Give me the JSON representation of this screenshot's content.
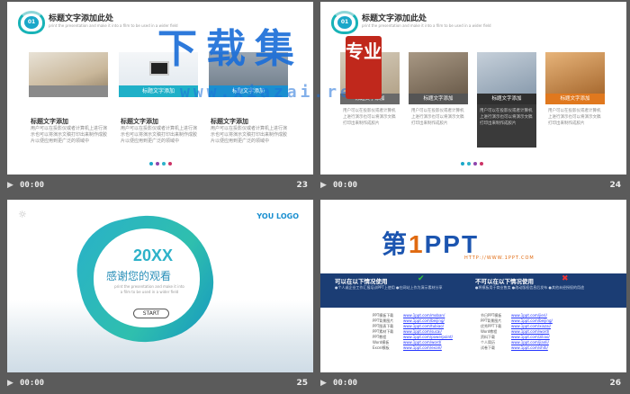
{
  "slides": [
    {
      "number": "23",
      "time": "00:00",
      "badge": "01",
      "title": "标题文字添加此处",
      "subtitle": "print the presentation and make it into a film to be used in a wider field",
      "photos": [
        {
          "caption": "",
          "color": "#c9b79a"
        },
        {
          "caption": "标题文字添加",
          "color": "#dfe7ee"
        },
        {
          "caption": "标题文字添加",
          "color": "#b8c2cc"
        }
      ],
      "photo_caption_colors": [
        "#8a8a8a",
        "#1fb0c8",
        "#1a8fd0"
      ],
      "columns": [
        {
          "title": "标题文字添加",
          "text": "用户可以在投影仪或者计算机上进行演示也可以将演示文稿打印出来制作成胶片以便应用到更广泛的领域中"
        },
        {
          "title": "标题文字添加",
          "text": "用户可以在投影仪或者计算机上进行演示也可以将演示文稿打印出来制作成胶片以便应用到更广泛的领域中"
        },
        {
          "title": "标题文字添加",
          "text": "用户可以在投影仪或者计算机上进行演示也可以将演示文稿打印出来制作成胶片以便应用到更广泛的领域中"
        }
      ],
      "dot_colors": [
        "#1aa7c9",
        "#8e44ad",
        "#2eb2c9",
        "#cc3366"
      ]
    },
    {
      "number": "24",
      "time": "00:00",
      "badge": "01",
      "title": "标题文字添加此处",
      "subtitle": "print the presentation and make it into a film to be used in a wider field",
      "cards": [
        {
          "caption": "标题文字添加",
          "text": "用户可以在投影仪或者计算机上进行演示也可以将演示文稿打印出来制作成胶片",
          "color": "#b4a48a",
          "cap_color": "#6a6a6a"
        },
        {
          "caption": "标题文字添加",
          "text": "用户可以在投影仪或者计算机上进行演示也可以将演示文稿打印出来制作成胶片",
          "color": "#8a7a66",
          "cap_color": "#555"
        },
        {
          "caption": "标题文字添加",
          "text": "用户可以在投影仪或者计算机上进行演示也可以将演示文稿打印出来制作成胶片",
          "color": "#9fb0c2",
          "cap_color": "#2f2f2f"
        },
        {
          "caption": "标题文字添加",
          "text": "用户可以在投影仪或者计算机上进行演示也可以将演示文稿打印出来制作成胶片",
          "color": "#c98a4a",
          "cap_color": "#e0781e"
        }
      ],
      "dot_colors": [
        "#1aa7c9",
        "#2eb2c9",
        "#8e44ad",
        "#cc3366"
      ]
    },
    {
      "number": "25",
      "time": "00:00",
      "logo": "YOU LOGO",
      "year": "20XX",
      "thanks": "感谢您的观看",
      "sub": "print the presentation and make it into a film to be used in a wider field",
      "start": "START"
    },
    {
      "number": "26",
      "time": "00:00",
      "logo_a": "第",
      "logo_one": "1",
      "logo_b": "PPT",
      "url": "HTTP://WWW.1PPT.COM",
      "allowed_title": "可以在以下情况使用",
      "allowed_text": "●个人或企业工作汇报培训PPT上使用 ●在网站上作为演示素材分享",
      "denied_title": "不可以在以下情况使用",
      "denied_text": "●将模板用于商业售卖 ●改动版权信息后发布 ●其他未经授权的用途",
      "links_left": [
        {
          "k": "PPT模板下载",
          "v": "www.1ppt.com/moban/"
        },
        {
          "k": "PPT背景图片",
          "v": "www.1ppt.com/beijing/"
        },
        {
          "k": "PPT图表下载",
          "v": "www.1ppt.com/tubiao/"
        },
        {
          "k": "PPT素材下载",
          "v": "www.1ppt.com/sucai/"
        },
        {
          "k": "PPT教程",
          "v": "www.1ppt.com/powerpoint/"
        },
        {
          "k": "Word模板",
          "v": "www.1ppt.com/word/"
        },
        {
          "k": "Excel模板",
          "v": "www.1ppt.com/excel/"
        }
      ],
      "links_right": [
        {
          "k": "节日PPT模板",
          "v": "www.1ppt.com/jieri/"
        },
        {
          "k": "PPT背景图片",
          "v": "www.1ppt.com/beijing/"
        },
        {
          "k": "优秀PPT下载",
          "v": "www.1ppt.com/xiazai/"
        },
        {
          "k": "Word教程",
          "v": "www.1ppt.com/word/"
        },
        {
          "k": "资料下载",
          "v": "www.1ppt.com/ziliao/"
        },
        {
          "k": "个人简历",
          "v": "www.1ppt.com/jianli/"
        },
        {
          "k": "试卷下载",
          "v": "www.1ppt.com/shiti/"
        }
      ]
    }
  ],
  "watermark": {
    "text": "下载集",
    "url": "www.xiazai.red",
    "seal": "专业"
  }
}
